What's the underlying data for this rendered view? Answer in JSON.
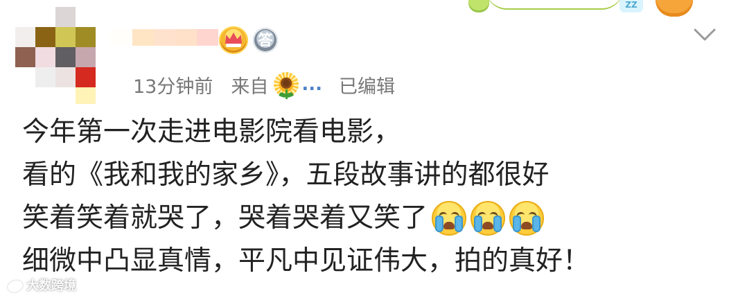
{
  "post": {
    "meta": {
      "time_ago": "13分钟前",
      "source_prefix": "来自",
      "source_more": "...",
      "edited": "已编辑"
    },
    "badges": {
      "medal_text": "答"
    },
    "content_lines": [
      "今年第一次走进电影院看电影，",
      "看的《我和我的家乡》，五段故事讲的都很好",
      "笑着笑着就哭了，哭着哭着又笑了",
      "细微中凸显真情，平凡中见证伟大，拍的真好！"
    ]
  },
  "watermark": {
    "text": "大数跨境"
  },
  "top_decoration": {
    "zz_text": "ZZ"
  },
  "icons": {
    "dropdown": "chevron-down-icon",
    "crown": "crown-badge-icon",
    "medal": "medal-badge-icon",
    "sunflower": "sunflower-icon",
    "emoji": "crying-face-icon"
  }
}
